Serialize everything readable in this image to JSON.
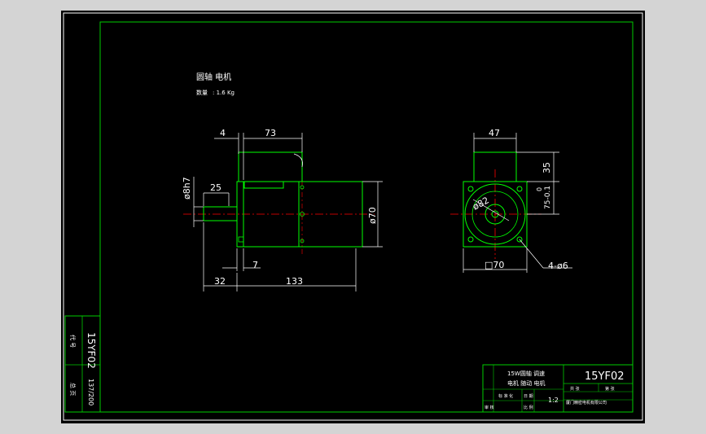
{
  "colors": {
    "background": "#000000",
    "frame": "#ffffff",
    "border": "#00cc00",
    "part": "#00ff00",
    "dimension": "#ffffff",
    "centerline": "#ff0000",
    "viewport": "#d4d4d4"
  },
  "header": {
    "title": "圆轴 电机",
    "weight_label": "数量",
    "weight_value": ": 1.6 Kg"
  },
  "side_view": {
    "dims": {
      "d4": "4",
      "d73": "73",
      "d25": "25",
      "shaft_dia": "ø8h7",
      "body_dia": "ø70",
      "d7": "7",
      "d32": "32",
      "d133": "133"
    }
  },
  "front_view": {
    "dims": {
      "d47": "47",
      "d35": "35",
      "tol": "0",
      "d75": "75-0.1",
      "pcd": "ø82",
      "square": "□70",
      "holes": "4-ø6"
    }
  },
  "side_block": {
    "code": "15YF02",
    "sheet": "137/200",
    "label1": "代 号",
    "label2": "总 页"
  },
  "title_block": {
    "name_line1": "15W圆轴 调速",
    "name_line2": "电机 随动 电机",
    "code": "15YF02",
    "scale": "1:2",
    "small1": "标 准 化",
    "small2": "日 期",
    "small3": "审 核",
    "small4": "比 例",
    "hdr1": "共  张",
    "hdr2": "第  张",
    "company": "厦门精密电机有限公司"
  }
}
